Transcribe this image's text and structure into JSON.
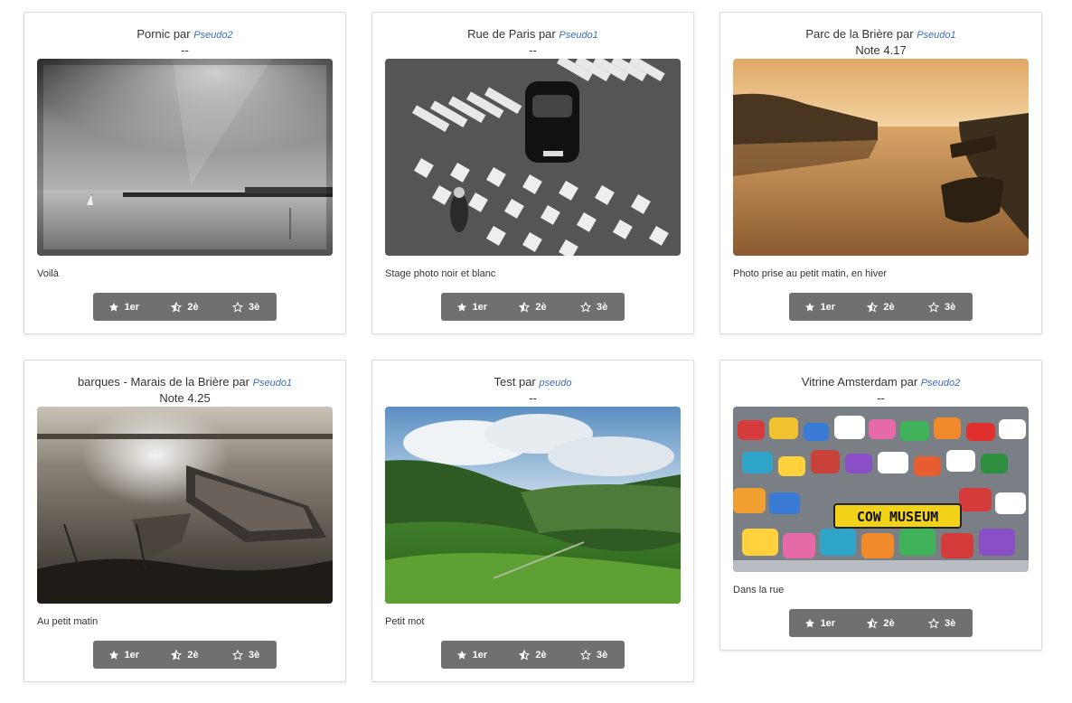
{
  "by_label": "par",
  "photos": [
    {
      "title": "Pornic",
      "author": "Pseudo2",
      "note": "--",
      "caption": "Voilà",
      "image_desc_icon": "photo-seascape-bw"
    },
    {
      "title": "Rue de Paris",
      "author": "Pseudo1",
      "note": "--",
      "caption": "Stage photo noir et blanc",
      "image_desc_icon": "photo-street-bw"
    },
    {
      "title": "Parc de la Brière",
      "author": "Pseudo1",
      "note": "Note 4.17",
      "caption": "Photo prise au petit matin, en hiver",
      "image_desc_icon": "photo-marsh-sunrise"
    },
    {
      "title": "barques - Marais de la Brière",
      "author": "Pseudo1",
      "note": "Note 4.25",
      "caption": "Au petit matin",
      "image_desc_icon": "photo-boats-sepia"
    },
    {
      "title": "Test",
      "author": "pseudo",
      "note": "--",
      "caption": "Petit mot",
      "image_desc_icon": "photo-green-valley"
    },
    {
      "title": "Vitrine Amsterdam",
      "author": "Pseudo2",
      "note": "--",
      "caption": "Dans la rue",
      "image_desc_icon": "photo-cow-museum",
      "sign_text": "COW MUSEUM"
    }
  ],
  "vote_buttons": [
    {
      "label": "1er",
      "icon": "star-full-icon"
    },
    {
      "label": "2è",
      "icon": "star-half-icon"
    },
    {
      "label": "3è",
      "icon": "star-empty-icon"
    }
  ],
  "colors": {
    "author_link": "#3a6fb5",
    "button_bg": "#707070",
    "button_text": "#ffffff"
  }
}
